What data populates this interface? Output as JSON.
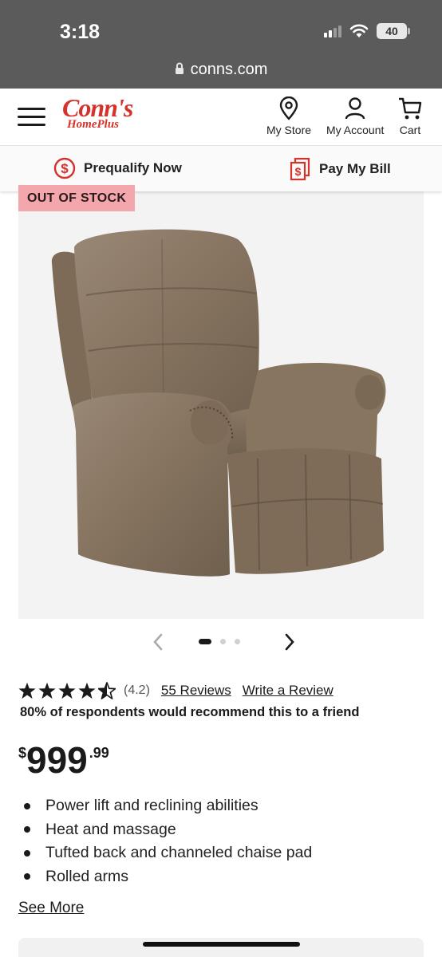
{
  "status_bar": {
    "time": "3:18",
    "battery": "40"
  },
  "browser": {
    "url": "conns.com"
  },
  "header": {
    "logo_main": "Conn's",
    "logo_sub": "HomePlus",
    "store_label": "My Store",
    "account_label": "My Account",
    "cart_label": "Cart"
  },
  "action_bar": {
    "prequalify_label": "Prequalify Now",
    "pay_bill_label": "Pay My Bill"
  },
  "product": {
    "badge": "OUT OF STOCK",
    "image_count": 3,
    "active_image": 1,
    "rating": 4.2,
    "rating_text": "(4.2)",
    "reviews_link": "55 Reviews",
    "write_review_link": "Write a Review",
    "recommend_pct": "80%",
    "recommend_text": "of respondents would recommend this to a friend",
    "price_currency": "$",
    "price_dollars": "999",
    "price_cents": ".99",
    "features": [
      "Power lift and reclining abilities",
      "Heat and massage",
      "Tufted back and channeled chaise pad",
      "Rolled arms"
    ],
    "see_more": "See More"
  },
  "colors": {
    "brand_red": "#d4322b",
    "badge_pink": "#f3a7ad"
  }
}
